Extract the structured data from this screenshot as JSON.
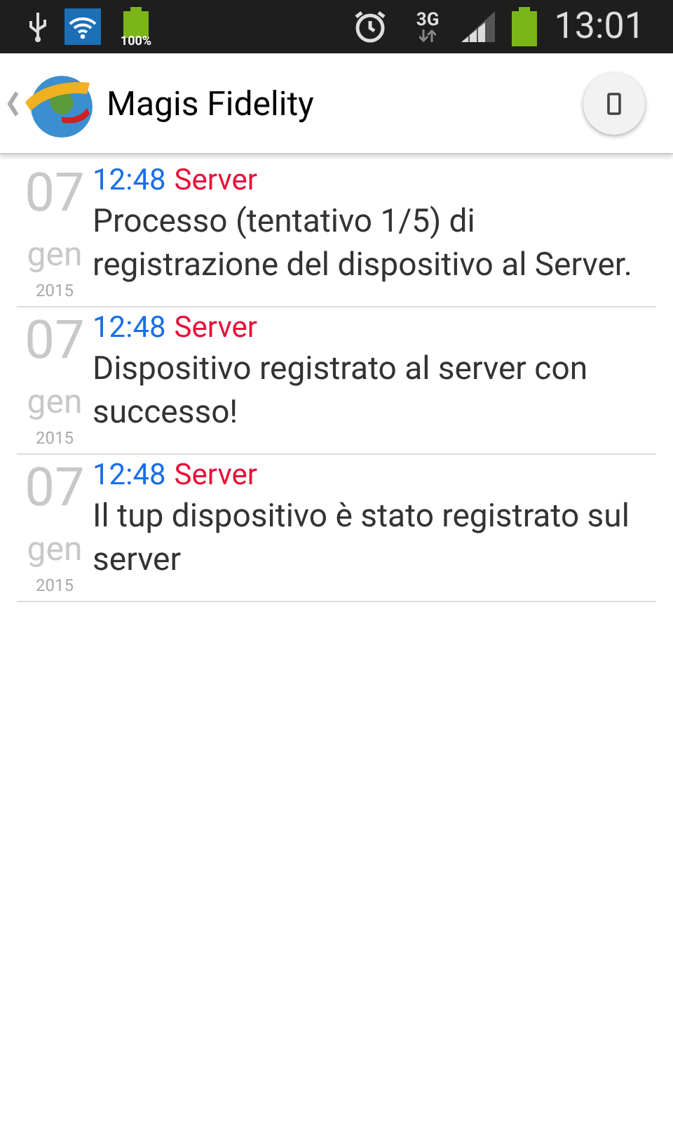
{
  "status_bar": {
    "battery_label": "100%",
    "network": "3G",
    "time": "13:01"
  },
  "action_bar": {
    "title": "Magis Fidelity"
  },
  "messages": [
    {
      "day": "07",
      "month": "gen",
      "year": "2015",
      "time": "12:48",
      "source": "Server",
      "text": "Processo (tentativo 1/5) di registrazione del dispositivo al Server."
    },
    {
      "day": "07",
      "month": "gen",
      "year": "2015",
      "time": "12:48",
      "source": "Server",
      "text": "Dispositivo registrato al server con successo!"
    },
    {
      "day": "07",
      "month": "gen",
      "year": "2015",
      "time": "12:48",
      "source": "Server",
      "text": "Il tup dispositivo è stato registrato sul server"
    }
  ]
}
